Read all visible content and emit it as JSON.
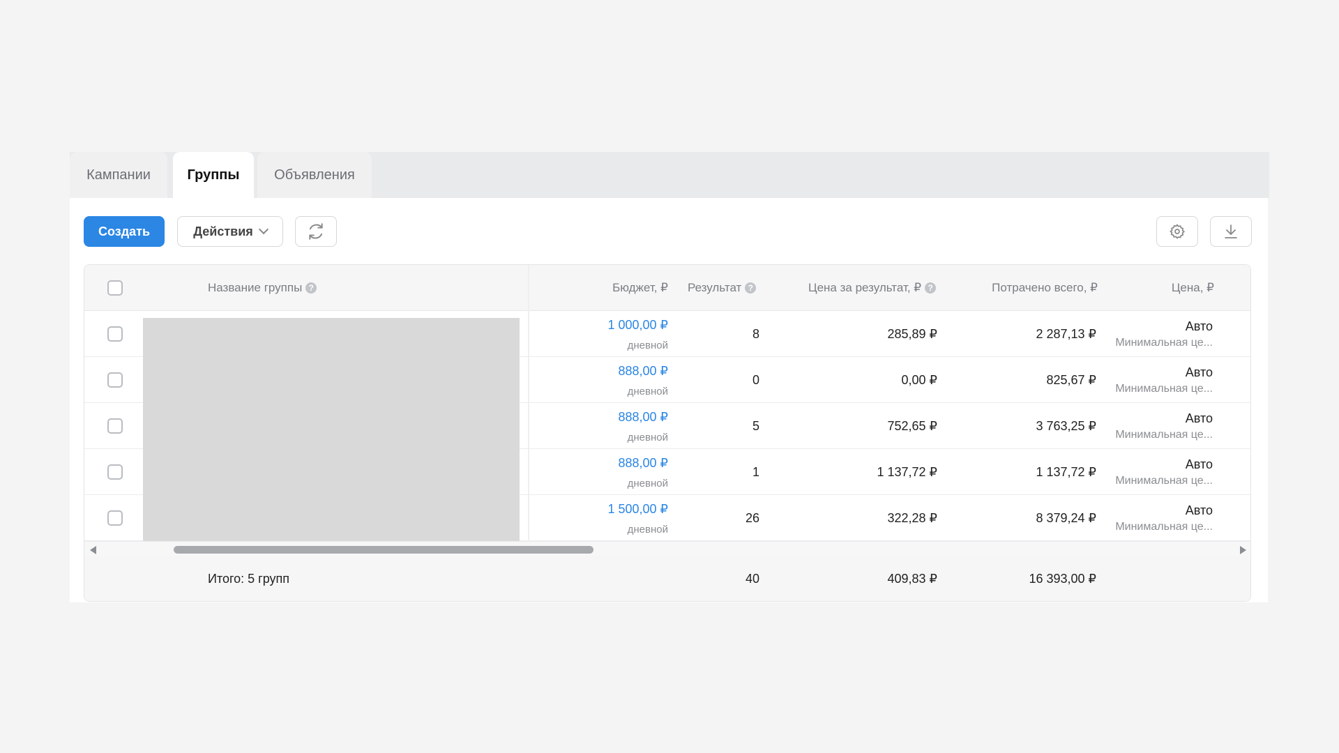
{
  "tabs": [
    {
      "label": "Кампании"
    },
    {
      "label": "Группы"
    },
    {
      "label": "Объявления"
    }
  ],
  "toolbar": {
    "create_label": "Создать",
    "actions_label": "Действия"
  },
  "table": {
    "headers": {
      "name": "Название группы",
      "budget": "Бюджет, ₽",
      "result": "Результат",
      "cost_per_result": "Цена за результат, ₽",
      "spent_total": "Потрачено всего, ₽",
      "price": "Цена, ₽"
    },
    "rows": [
      {
        "budget": "1 000,00 ₽",
        "budget_type": "дневной",
        "result": "8",
        "cost_per_result": "285,89 ₽",
        "spent": "2 287,13 ₽",
        "price": "Авто",
        "price_sub": "Минимальная це..."
      },
      {
        "budget": "888,00 ₽",
        "budget_type": "дневной",
        "result": "0",
        "cost_per_result": "0,00 ₽",
        "spent": "825,67 ₽",
        "price": "Авто",
        "price_sub": "Минимальная це..."
      },
      {
        "budget": "888,00 ₽",
        "budget_type": "дневной",
        "result": "5",
        "cost_per_result": "752,65 ₽",
        "spent": "3 763,25 ₽",
        "price": "Авто",
        "price_sub": "Минимальная це..."
      },
      {
        "budget": "888,00 ₽",
        "budget_type": "дневной",
        "result": "1",
        "cost_per_result": "1 137,72 ₽",
        "spent": "1 137,72 ₽",
        "price": "Авто",
        "price_sub": "Минимальная це..."
      },
      {
        "budget": "1 500,00 ₽",
        "budget_type": "дневной",
        "result": "26",
        "cost_per_result": "322,28 ₽",
        "spent": "8 379,24 ₽",
        "price": "Авто",
        "price_sub": "Минимальная це..."
      }
    ],
    "footer": {
      "label": "Итого: 5 групп",
      "result": "40",
      "cost_per_result": "409,83 ₽",
      "spent": "16 393,00 ₽"
    }
  },
  "colors": {
    "accent": "#2b86e4",
    "background": "#f4f4f4"
  },
  "icons": [
    "refresh-icon",
    "gear-icon",
    "download-icon",
    "help-icon",
    "chevron-down-icon"
  ]
}
